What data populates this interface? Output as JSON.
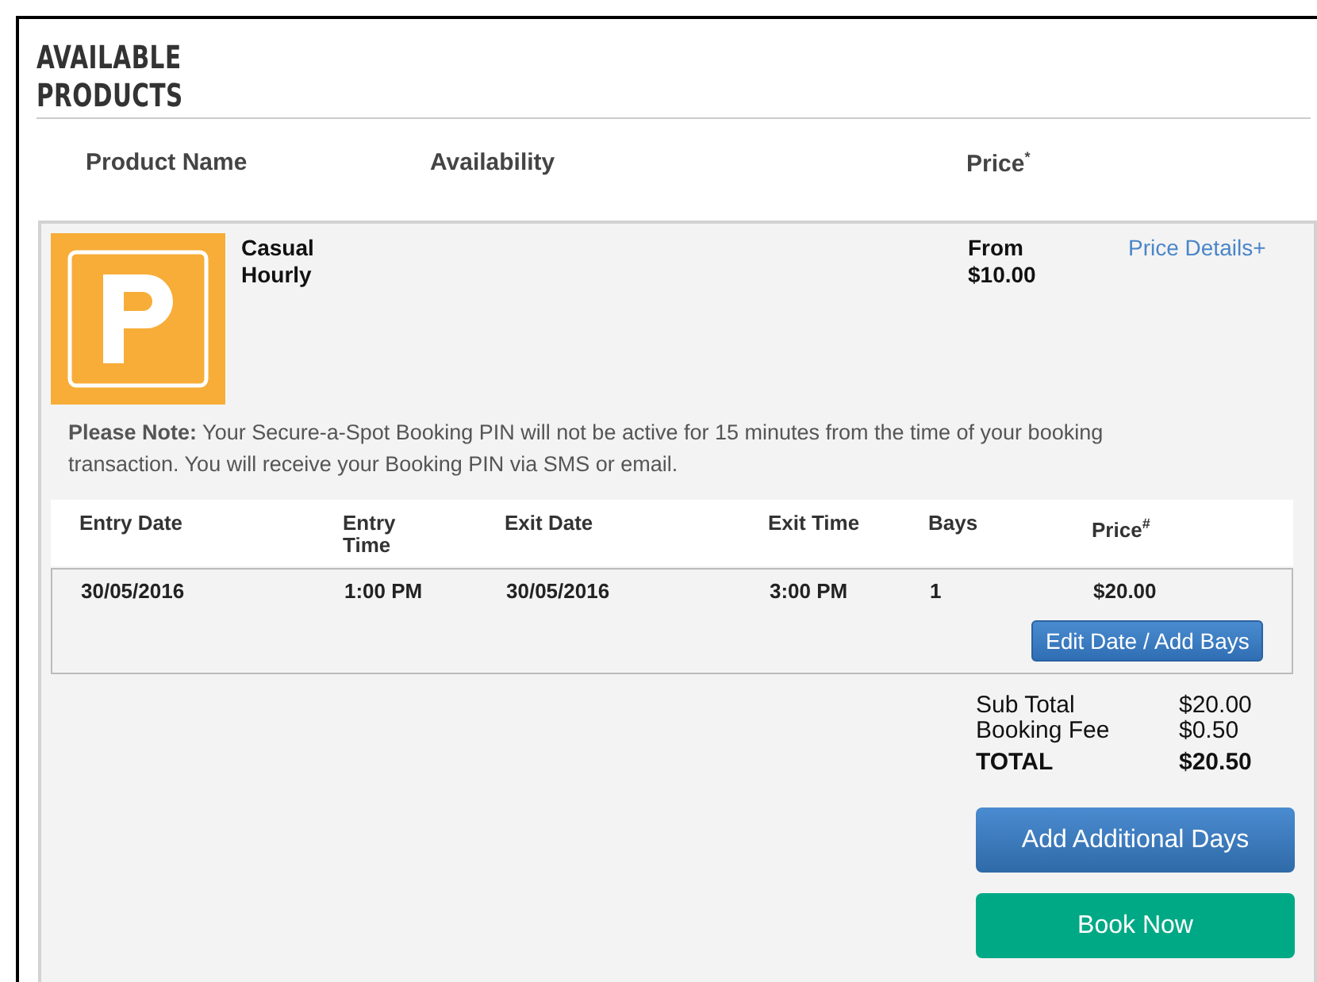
{
  "heading": "AVAILABLE PRODUCTS",
  "columns": [
    "Product Name",
    "Availability",
    "Price$^{*}$"
  ],
  "product": {
    "name_lines": [
      "Casual",
      "Hourly"
    ],
    "price_lines": [
      "From",
      "$10.00"
    ],
    "details_link": "Price Details+",
    "note": "**Please Note:** Your Secure-a-Spot Booking PIN will not be active for 15 minutes from the time of your booking transaction. You will receive your Booking PIN via SMS or email.",
    "booking_table": {
      "columns": [
        "Entry Date",
        "Entry Time",
        "Exit Date",
        "Exit Time",
        "Bays",
        "Price$^{#}$"
      ],
      "rows": [
        [
          "30/05/2016",
          "1:00 PM",
          "30/05/2016",
          "3:00 PM",
          "1",
          "$20.00"
        ]
      ],
      "edit_button": "Edit Date / Add Bays"
    },
    "totals": [
      {
        "label": "Sub Total",
        "value": "$20.00",
        "kind": "normal"
      },
      {
        "label": "Booking Fee",
        "value": "$0.50",
        "kind": "normal"
      },
      {
        "label": "TOTAL",
        "value": "$20.50",
        "kind": "grand"
      }
    ],
    "buttons": [
      {
        "label": "Add Additional Days",
        "kind": "secondary"
      },
      {
        "label": "Book Now",
        "kind": "primary"
      }
    ]
  }
}
